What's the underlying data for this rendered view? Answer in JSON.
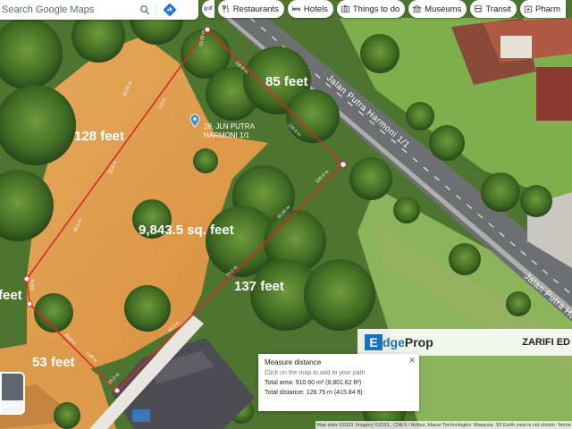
{
  "search": {
    "placeholder": "Search Google Maps"
  },
  "chips": [
    {
      "label": "Restaurants",
      "icon": "fork-knife-icon"
    },
    {
      "label": "Hotels",
      "icon": "bed-icon"
    },
    {
      "label": "Things to do",
      "icon": "camera-icon"
    },
    {
      "label": "Museums",
      "icon": "museum-icon"
    },
    {
      "label": "Transit",
      "icon": "bus-icon"
    },
    {
      "label": "Pharm",
      "icon": "pharmacy-icon"
    }
  ],
  "chip_partial_left": "golf",
  "map": {
    "road_name_1": "Jalan Putra Harmoni 1/1",
    "road_name_2": "Jalan Putra Harmoni",
    "poi_line1": "29, JLN PUTRA",
    "poi_line2": "HARMONI 1/1",
    "labels": {
      "top": "85 feet",
      "left": "128 feet",
      "area": "9,843.5 sq. feet",
      "right": "137 feet",
      "bottom": "53 feet",
      "left_edge": "feet"
    },
    "segment_labels": [
      "10.00 m",
      "5.0 m",
      "116.0 m",
      "120.0 m",
      "20.0 m",
      "30.0 m",
      "30.00 m",
      "75.0 m",
      "40.0 m",
      "3.0 m",
      "30.0 m",
      "20.0 m",
      "5.00 m",
      "10.00 m",
      "100.0 m"
    ]
  },
  "layers": {
    "label": "ayers"
  },
  "measure": {
    "title": "Measure distance",
    "hint": "Click on the map to add to your path",
    "area": "Total area: 910.60 m² (9,801.62 ft²)",
    "distance": "Total distance: 126.75 m (415.84 ft)"
  },
  "watermark": {
    "brand_e": "E",
    "brand_dge": "dge",
    "brand_prop": "Prop",
    "agent": "ZARIFI ED"
  },
  "footer": {
    "data": "Map data ©2023",
    "imagery": "Imagery ©2023 , CNES / Airbus, Maxar Technologies",
    "country": "Malaysia",
    "note": "3D Earth view is not shown",
    "terms": "Terms"
  }
}
